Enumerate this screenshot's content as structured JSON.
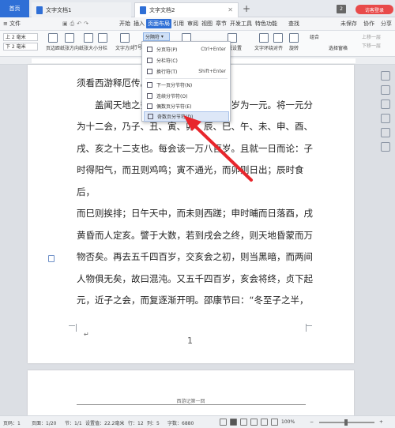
{
  "tabs": {
    "home": "首页",
    "doc1": "文字文档1",
    "doc2": "文字文档2",
    "window_count": "2",
    "login": "访客登录"
  },
  "menubar": {
    "file": "≡ 文件",
    "items": [
      "开始",
      "插入",
      "页面布局",
      "引用",
      "审阅",
      "视图",
      "章节",
      "开发工具",
      "特色功能"
    ],
    "active_index": 2,
    "search": "查找",
    "right": [
      "未保存",
      "协作",
      "分享"
    ]
  },
  "ribbon": {
    "margin_top": "上 2 毫米",
    "margin_bottom": "下 2 毫米",
    "buttons": [
      "页边距",
      "纸张方向",
      "纸张大小",
      "分栏",
      "文字方向",
      "行号",
      "分隔符",
      "",
      "",
      "稿纸设置",
      "文字环绕",
      "对齐",
      "旋转",
      "选择窗格"
    ],
    "divider_dropdown": "分隔符",
    "right_col1": [
      "组合",
      "上移一层"
    ],
    "right_col2": [
      "上移一层",
      "下移一层"
    ]
  },
  "dropdown": {
    "items": [
      {
        "label": "分页符(P)",
        "shortcut": "Ctrl+Enter"
      },
      {
        "label": "分栏符(C)",
        "shortcut": ""
      },
      {
        "label": "换行符(T)",
        "shortcut": "Shift+Enter"
      },
      {
        "label": "下一页分节符(N)",
        "shortcut": ""
      },
      {
        "label": "连续分节符(O)",
        "shortcut": ""
      },
      {
        "label": "偶数页分节符(E)",
        "shortcut": ""
      },
      {
        "label": "奇数页分节符(D)",
        "shortcut": ""
      }
    ],
    "highlighted_index": 6
  },
  "document": {
    "lines": [
      "须看西游释厄传。",
      "　　盖闻天地之数，有十二万九千六百岁为一元。将一元分",
      "为十二会，乃子、丑、寅、卯、辰、巳、午、未、申、酉、",
      "戌、亥之十二支也。每会该一万八百岁。且就一日而论：子",
      "时得阳气，而丑则鸡鸣；寅不通光，而卯则日出；辰时食后，",
      "而巳则挨排；日午天中，而未则西蹉；申时晡而日落酉，戌",
      "黄昏而人定亥。譬于大数，若到戌会之终，则天地昏蒙而万",
      "物否矣。再去五千四百岁，交亥会之初，则当黑暗，而两间",
      "人物俱无矣，故曰混沌。又五千四百岁，亥会将终，贞下起",
      "元，近子之会，而复逐渐开明。邵康节曰：“冬至子之半，"
    ],
    "page_number": "1",
    "page2_header": "西游记第一回"
  },
  "statusbar": {
    "page": "页码：1",
    "pages": "页面：1/20",
    "section": "节：1/1",
    "setting": "设置值：22.2毫米",
    "row": "行：12",
    "col": "列：5",
    "words": "字数：6880",
    "zoom": "100%"
  }
}
